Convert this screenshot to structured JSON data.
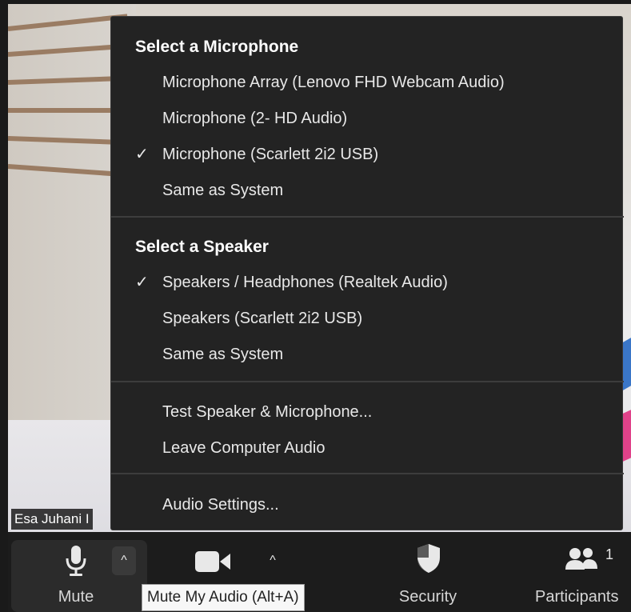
{
  "video": {
    "participant_name": "Esa Juhani I"
  },
  "audio_menu": {
    "microphone_heading": "Select a Microphone",
    "microphones": [
      {
        "label": "Microphone Array (Lenovo FHD Webcam Audio)",
        "checked": false
      },
      {
        "label": "Microphone (2- HD Audio)",
        "checked": false
      },
      {
        "label": "Microphone (Scarlett 2i2 USB)",
        "checked": true
      },
      {
        "label": "Same as System",
        "checked": false
      }
    ],
    "speaker_heading": "Select a Speaker",
    "speakers": [
      {
        "label": "Speakers / Headphones (Realtek Audio)",
        "checked": true
      },
      {
        "label": "Speakers (Scarlett 2i2 USB)",
        "checked": false
      },
      {
        "label": "Same as System",
        "checked": false
      }
    ],
    "test_label": "Test Speaker & Microphone...",
    "leave_label": "Leave Computer Audio",
    "settings_label": "Audio Settings...",
    "check_glyph": "✓"
  },
  "toolbar": {
    "mute_label": "Mute",
    "security_label": "Security",
    "participants_label": "Participants",
    "participants_count": "1",
    "caret_glyph": "^"
  },
  "tooltip": {
    "text": "Mute My Audio (Alt+A)"
  },
  "colors": {
    "menu_bg": "#232323",
    "toolbar_bg": "#1c1c1c",
    "tooltip_bg": "#f7f7f7"
  },
  "icons": [
    "microphone-icon",
    "video-camera-icon",
    "shield-icon",
    "participants-icon",
    "check-icon",
    "chevron-up-icon"
  ]
}
